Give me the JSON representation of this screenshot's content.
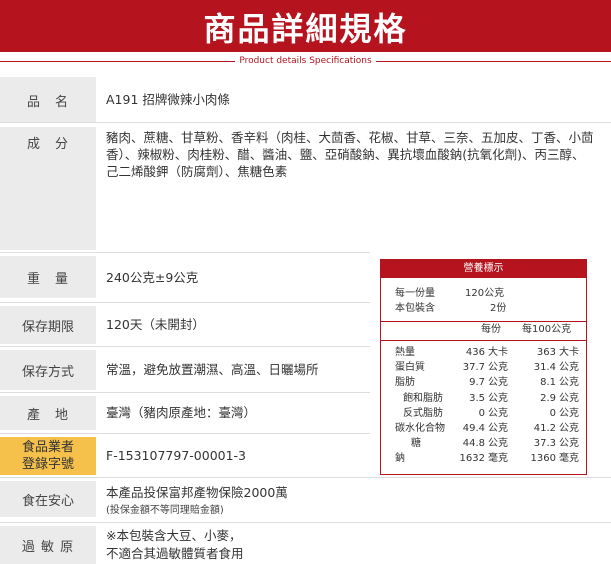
{
  "header": {
    "title": "商品詳細規格",
    "subtitle": "Product details Specifications"
  },
  "specs": {
    "name_label": "品　名",
    "name_value": "A191 招牌微辣小肉條",
    "ingredients_label": "成　分",
    "ingredients_value": "豬肉、蔗糖、甘草粉、香辛料（肉桂、大茴香、花椒、甘草、三奈、五加皮、丁香、小茴香）、辣椒粉、肉桂粉、醋、醬油、鹽、亞硝酸鈉、異抗壞血酸鈉(抗氧化劑)、丙三醇、己二烯酸鉀（防腐劑）、焦糖色素",
    "weight_label": "重　量",
    "weight_value": "240公克±9公克",
    "shelf_label": "保存期限",
    "shelf_value": "120天（未開封）",
    "storage_label": "保存方式",
    "storage_value": "常溫，避免放置潮濕、高溫、日曬場所",
    "origin_label": "產　地",
    "origin_value": "臺灣（豬肉原產地：臺灣）",
    "registration_label_1": "食品業者",
    "registration_label_2": "登錄字號",
    "registration_value": "F-153107797-00001-3",
    "safety_label": "食在安心",
    "safety_value": "本產品投保富邦產物保險2000萬",
    "safety_note": "(投保金額不等同理賠金額)",
    "allergen_label": "過 敏 原",
    "allergen_line1": "※本包裝含大豆、小麥，",
    "allergen_line2": "不適合其過敏體質者食用"
  },
  "nutrition": {
    "title": "營養標示",
    "serving_size_label": "每一份量",
    "serving_size_value": "120公克",
    "servings_label": "本包裝含",
    "servings_value": "2份",
    "col_per_serving": "每份",
    "col_per_100g": "每100公克",
    "rows": [
      {
        "name": "熱量",
        "per": "436",
        "unit": "大卡",
        "per100": "363",
        "unit100": "大卡"
      },
      {
        "name": "蛋白質",
        "per": "37.7",
        "unit": "公克",
        "per100": "31.4",
        "unit100": "公克"
      },
      {
        "name": "脂肪",
        "per": "9.7",
        "unit": "公克",
        "per100": "8.1",
        "unit100": "公克"
      },
      {
        "name": "飽和脂肪",
        "per": "3.5",
        "unit": "公克",
        "per100": "2.9",
        "unit100": "公克"
      },
      {
        "name": "反式脂肪",
        "per": "0",
        "unit": "公克",
        "per100": "0",
        "unit100": "公克"
      },
      {
        "name": "碳水化合物",
        "per": "49.4",
        "unit": "公克",
        "per100": "41.2",
        "unit100": "公克"
      },
      {
        "name": "糖",
        "per": "44.8",
        "unit": "公克",
        "per100": "37.3",
        "unit100": "公克"
      },
      {
        "name": "鈉",
        "per": "1632",
        "unit": "毫克",
        "per100": "1360",
        "unit100": "毫克"
      }
    ]
  }
}
